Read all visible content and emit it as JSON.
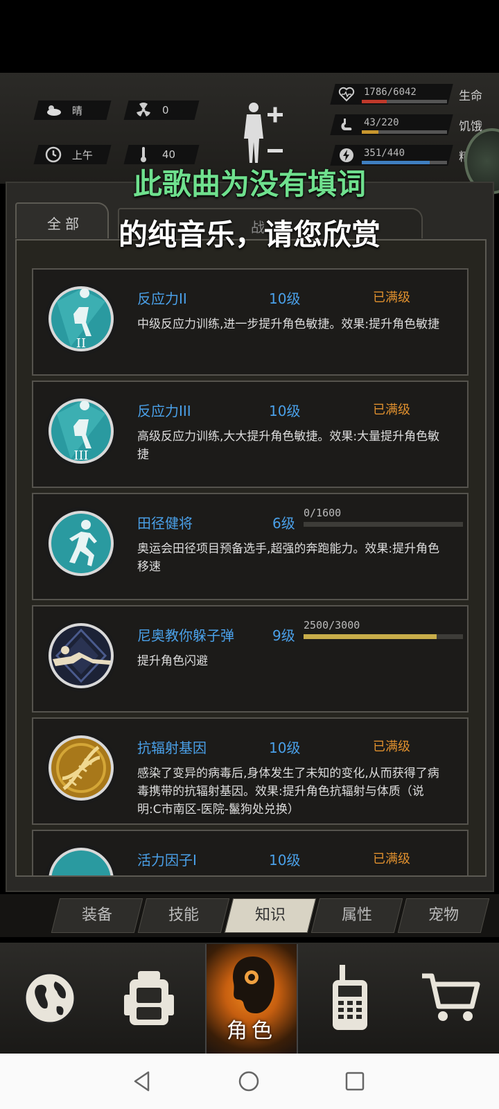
{
  "hud": {
    "weather": "晴",
    "radiation": "0",
    "time_of_day": "上午",
    "temperature": "40",
    "stats": [
      {
        "label": "生命",
        "value": "1786/6042",
        "fraction": 0.296,
        "color": "#c0392b",
        "icon": "heart-icon"
      },
      {
        "label": "饥饿",
        "value": "43/220",
        "fraction": 0.195,
        "color": "#c8962e",
        "icon": "stomach-icon"
      },
      {
        "label": "精力",
        "value": "351/440",
        "fraction": 0.8,
        "color": "#3f7fc0",
        "icon": "energy-icon"
      }
    ]
  },
  "overlay": {
    "line1": "此歌曲为没有填词",
    "line2": "的纯音乐，请您欣赏"
  },
  "tabs": {
    "all": "全部",
    "combat": "战"
  },
  "cards": [
    {
      "name": "反应力II",
      "level": "10级",
      "status": "已满级",
      "desc": "中级反应力训练,进一步提升角色敏捷。效果:提升角色敏捷",
      "emblem": "agility-ii-emblem"
    },
    {
      "name": "反应力III",
      "level": "10级",
      "status": "已满级",
      "desc": "高级反应力训练,大大提升角色敏捷。效果:大量提升角色敏捷",
      "emblem": "agility-iii-emblem"
    },
    {
      "name": "田径健将",
      "level": "6级",
      "progress_text": "0/1600",
      "progress": 0.0,
      "desc": "奥运会田径项目预备选手,超强的奔跑能力。效果:提升角色移速",
      "emblem": "runner-emblem"
    },
    {
      "name": "尼奥教你躲子弹",
      "level": "9级",
      "progress_text": "2500/3000",
      "progress": 0.833,
      "desc": "提升角色闪避",
      "emblem": "dodge-emblem"
    },
    {
      "name": "抗辐射基因",
      "level": "10级",
      "status": "已满级",
      "desc": "感染了变异的病毒后,身体发生了未知的变化,从而获得了病毒携带的抗辐射基因。效果:提升角色抗辐射与体质（说明:C市南区-医院-鬣狗处兑换）",
      "emblem": "dna-emblem"
    },
    {
      "name": "活力因子I",
      "level": "10级",
      "status": "已满级",
      "desc": "",
      "emblem": "vitality-emblem"
    }
  ],
  "subtabs": [
    "装备",
    "技能",
    "知识",
    "属性",
    "宠物"
  ],
  "active_subtab": "知识",
  "nav": {
    "world": "world-map-icon",
    "backpack": "backpack-icon",
    "character_label": "角色",
    "radio": "radio-icon",
    "shop": "shopping-cart-icon"
  }
}
